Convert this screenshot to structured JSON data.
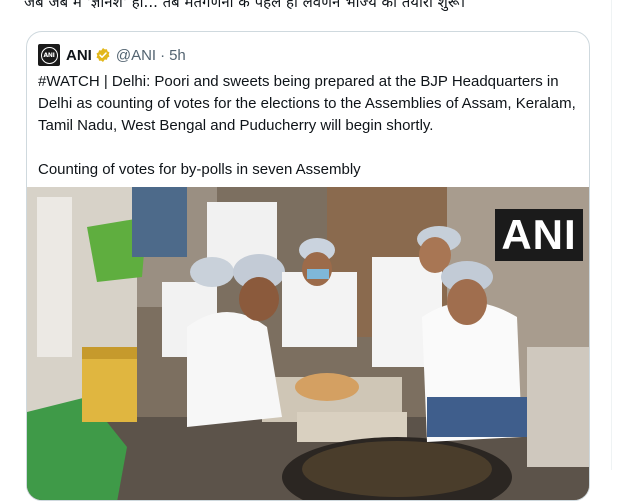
{
  "tweet": {
    "text": "जब जब मे 'ज्ञानेश' हो... तब मतगणना के पहले ही लवणन भोज्य की तयारी शुरू।"
  },
  "quote": {
    "avatar_text": "ANI",
    "display_name": "ANI",
    "handle": "@ANI",
    "separator": "·",
    "time": "5h",
    "body_lines": [
      "#WATCH | Delhi: Poori and sweets being prepared at the BJP Headquarters in Delhi as counting of votes for the elections to the Assemblies of Assam, Keralam, Tamil Nadu, West Bengal and Puducherry will begin shortly.",
      "Counting of votes for by-polls in seven Assembly"
    ],
    "media": {
      "watermark": "ANI"
    }
  },
  "colors": {
    "text": "#0f1419",
    "secondary": "#536471",
    "border": "#cfd9de",
    "verified_gold": "#e2b719"
  },
  "icons": {
    "verified": "verified-badge-icon",
    "avatar": "ani-logo-icon"
  }
}
